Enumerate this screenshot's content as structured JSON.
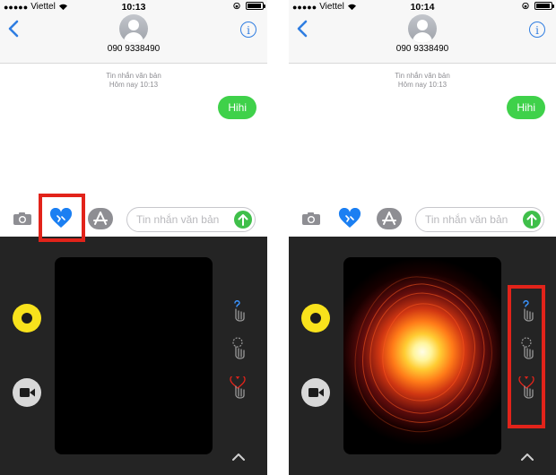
{
  "colors": {
    "ios_blue": "#2f7de1",
    "bubble_green": "#3fd14a",
    "highlight_red": "#e2231a",
    "record_yellow": "#f8e21c",
    "panel_dark": "#242424"
  },
  "screens": [
    {
      "status": {
        "carrier": "Viettel",
        "time": "10:13",
        "signal_bars": 5,
        "battery_level": 0.9
      },
      "header": {
        "contact": "090 9338490",
        "info_label": "i"
      },
      "thread": {
        "meta_line1": "Tin nhắn văn bản",
        "meta_line2": "Hôm nay 10:13",
        "messages": [
          "Hihi"
        ]
      },
      "compose": {
        "placeholder": "Tin nhắn văn bản"
      },
      "digital_touch": {
        "canvas_effect": "empty",
        "highlight": "heartbeat-button"
      },
      "icons": [
        "camera-icon",
        "digital-touch-heart-icon",
        "app-store-icon",
        "send-arrow-icon",
        "record-icon",
        "video-camera-icon",
        "tap-gesture-icon",
        "kiss-gesture-icon",
        "heartbreak-gesture-icon",
        "chevron-up-icon"
      ]
    },
    {
      "status": {
        "carrier": "Viettel",
        "time": "10:14",
        "signal_bars": 5,
        "battery_level": 0.9
      },
      "header": {
        "contact": "090 9338490",
        "info_label": "i"
      },
      "thread": {
        "meta_line1": "Tin nhắn văn bản",
        "meta_line2": "Hôm nay 10:13",
        "messages": [
          "Hihi"
        ]
      },
      "compose": {
        "placeholder": "Tin nhắn văn bản"
      },
      "digital_touch": {
        "canvas_effect": "fireball",
        "highlight": "gesture-list"
      },
      "icons": [
        "camera-icon",
        "digital-touch-heart-icon",
        "app-store-icon",
        "send-arrow-icon",
        "record-icon",
        "video-camera-icon",
        "tap-gesture-icon",
        "kiss-gesture-icon",
        "heartbreak-gesture-icon",
        "chevron-up-icon"
      ]
    }
  ]
}
